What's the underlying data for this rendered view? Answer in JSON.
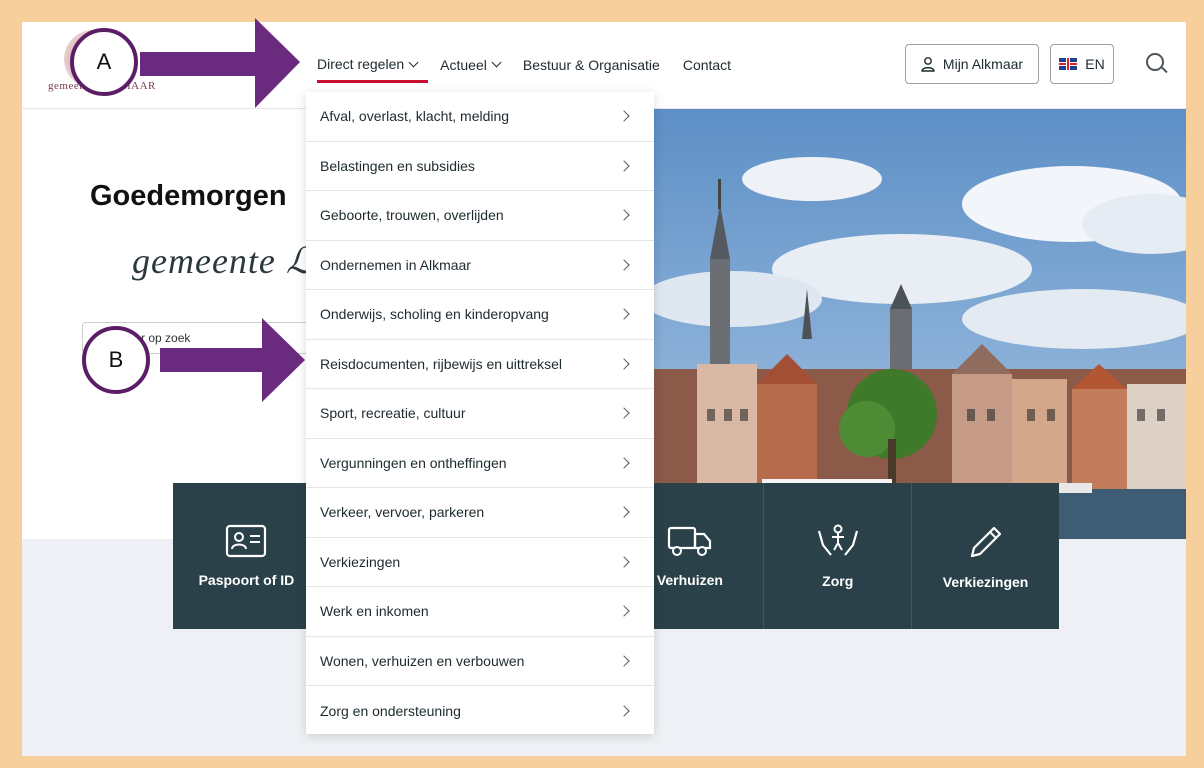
{
  "header": {
    "logo_text": "gemeente ALKMAAR",
    "nav": [
      {
        "label": "Direct regelen",
        "dropdown": true
      },
      {
        "label": "Actueel",
        "dropdown": true
      },
      {
        "label": "Bestuur & Organisatie",
        "dropdown": false
      },
      {
        "label": "Contact",
        "dropdown": false
      }
    ],
    "account_label": "Mijn Alkmaar",
    "language_label": "EN"
  },
  "hero": {
    "greeting": "Goedemorgen",
    "script_text": "gemeente ℒ",
    "search_placeholder": "ent u naar op zoek"
  },
  "dropdown": {
    "items": [
      "Afval, overlast, klacht, melding",
      "Belastingen en subsidies",
      "Geboorte, trouwen, overlijden",
      "Ondernemen in Alkmaar",
      "Onderwijs, scholing en kinderopvang",
      "Reisdocumenten, rijbewijs en uittreksel",
      "Sport, recreatie, cultuur",
      "Vergunningen en ontheffingen",
      "Verkeer, vervoer, parkeren",
      "Verkiezingen",
      "Werk en inkomen",
      "Wonen, verhuizen en verbouwen",
      "Zorg en ondersteuning"
    ]
  },
  "tiles": [
    {
      "label": "Paspoort of ID",
      "icon": "id-card-icon"
    },
    {
      "label": "",
      "icon": ""
    },
    {
      "label": "",
      "icon": ""
    },
    {
      "label": "Verhuizen",
      "icon": "truck-icon"
    },
    {
      "label": "Zorg",
      "icon": "care-hands-icon"
    },
    {
      "label": "Verkiezingen",
      "icon": "pencil-icon"
    }
  ],
  "annotations": {
    "a_label": "A",
    "b_label": "B",
    "arrow_color": "#6a2a7e"
  },
  "colors": {
    "frame": "#f6cf9d",
    "tile_bg": "#2b4149",
    "active_underline": "#c8102e"
  }
}
